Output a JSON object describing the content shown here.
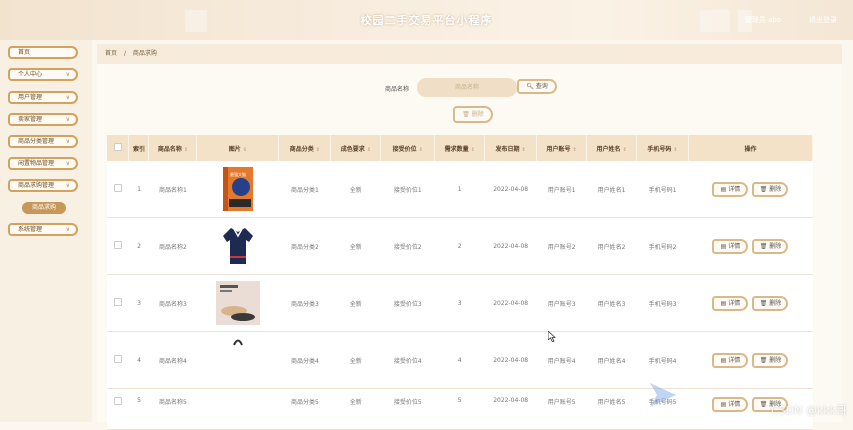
{
  "header": {
    "title": "校园二手交易平台小程序",
    "admin_label": "管理员 abo",
    "logout_label": "退出登录"
  },
  "sidebar": {
    "items": [
      {
        "label": "首页",
        "has_chevron": false
      },
      {
        "label": "个人中心",
        "has_chevron": true
      },
      {
        "label": "用户管理",
        "has_chevron": true
      },
      {
        "label": "卖家管理",
        "has_chevron": true
      },
      {
        "label": "商品分类管理",
        "has_chevron": true
      },
      {
        "label": "闲置物品管理",
        "has_chevron": true
      },
      {
        "label": "商品求购管理",
        "has_chevron": true
      },
      {
        "label": "系统管理",
        "has_chevron": true
      }
    ],
    "active_sub": "商品求购"
  },
  "breadcrumb": {
    "home": "首页",
    "separator": "/",
    "current": "商品求购"
  },
  "search": {
    "label": "商品名称",
    "placeholder": "商品名称",
    "button": "查询"
  },
  "toolbar": {
    "delete": "删除"
  },
  "table": {
    "headers": [
      "索引",
      "商品名称",
      "图片",
      "商品分类",
      "成色要求",
      "接受价位",
      "需求数量",
      "发布日期",
      "用户账号",
      "用户姓名",
      "手机号码",
      "操作"
    ],
    "rows": [
      {
        "index": "1",
        "name": "商品名称1",
        "category": "商品分类1",
        "condition": "全新",
        "price": "接受价位1",
        "qty": "1",
        "date": "2022-04-08",
        "account": "用户账号1",
        "user": "用户姓名1",
        "phone": "手机号码1"
      },
      {
        "index": "2",
        "name": "商品名称2",
        "category": "商品分类2",
        "condition": "全新",
        "price": "接受价位2",
        "qty": "2",
        "date": "2022-04-08",
        "account": "用户账号2",
        "user": "用户姓名2",
        "phone": "手机号码2"
      },
      {
        "index": "3",
        "name": "商品名称3",
        "category": "商品分类3",
        "condition": "全新",
        "price": "接受价位3",
        "qty": "3",
        "date": "2022-04-08",
        "account": "用户账号3",
        "user": "用户姓名3",
        "phone": "手机号码3"
      },
      {
        "index": "4",
        "name": "商品名称4",
        "category": "商品分类4",
        "condition": "全新",
        "price": "接受价位4",
        "qty": "4",
        "date": "2022-04-08",
        "account": "用户账号4",
        "user": "用户姓名4",
        "phone": "手机号码4"
      },
      {
        "index": "5",
        "name": "商品名称5",
        "category": "商品分类5",
        "condition": "全新",
        "price": "接受价位5",
        "qty": "5",
        "date": "2022-04-08",
        "account": "用户账号5",
        "user": "用户姓名5",
        "phone": "手机号码5"
      }
    ],
    "detail_label": "详情",
    "delete_label": "删除"
  },
  "thumb_book_text": "最强大脑",
  "watermark": "CSDN @kkk哥",
  "colors": {
    "accent": "#c6985a",
    "border": "#d3a25f",
    "header_bg": "#f4e2c8",
    "sidebar_bg": "#f8f0e2"
  },
  "icons": {
    "search": "search-icon",
    "detail": "detail-icon",
    "delete": "trash-icon",
    "sort": "sort-icon",
    "chevron": "chevron-down-icon"
  }
}
